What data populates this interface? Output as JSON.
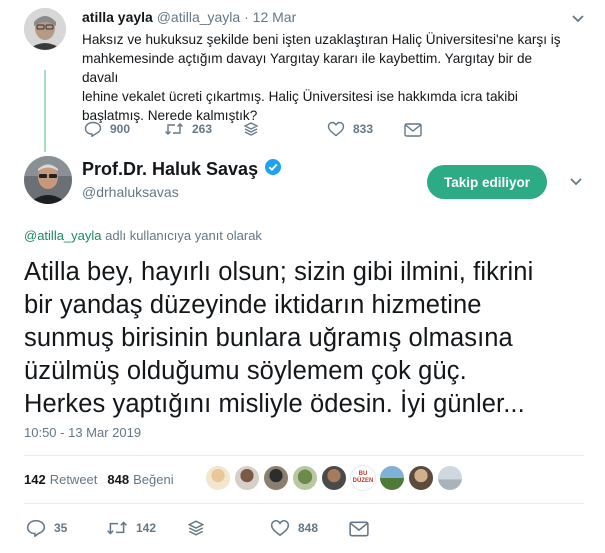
{
  "parent_tweet": {
    "name": "atilla yayla",
    "handle": "@atilla_yayla",
    "separator": "·",
    "time": "12 Mar",
    "text": "Haksız ve hukuksuz şekilde beni işten uzaklaştıran Haliç Üniversitesi'ne karşı iş\nmahkemesinde açtığım davayı Yargıtay kararı ile kaybettim. Yargıtay bir de davalı\nlehine vekalet ücreti çıkartmış. Haliç Üniversitesi ise hakkımda icra takibi\nbaşlatmış. Nerede kalmıştık?",
    "replies": "900",
    "retweets": "263",
    "likes": "833"
  },
  "main_tweet": {
    "name": "Prof.Dr. Haluk Savaş",
    "handle": "@drhaluksavas",
    "follow_label": "Takip ediliyor",
    "reply_mention": "@atilla_yayla",
    "reply_suffix": " adlı kullanıcıya yanıt olarak",
    "text": "Atilla bey, hayırlı olsun; sizin gibi ilmini, fikrini\nbir yandaş düzeyinde iktidarın hizmetine\nsunmuş birisinin bunlara uğramış olmasına\nüzülmüş olduğumu söylemem çok güç.\nHerkes yaptığını misliyle ödesin. İyi günler...",
    "timestamp": "10:50 - 13 Mar 2019",
    "retweet_count": "142",
    "retweet_label": "Retweet",
    "like_count": "848",
    "like_label": "Beğeni",
    "liker_badge_text": "BU DÜZEN",
    "replies": "35",
    "retweets": "142",
    "likes": "848"
  },
  "colors": {
    "accent": "#2cab84",
    "thread_line": "#a5ddc2",
    "muted": "#657786",
    "verified": "#1da1f2"
  },
  "icons": [
    "reply-icon",
    "retweet-icon",
    "share-icon",
    "heart-icon",
    "mail-icon",
    "chevron-down-icon",
    "verified-badge-icon"
  ]
}
